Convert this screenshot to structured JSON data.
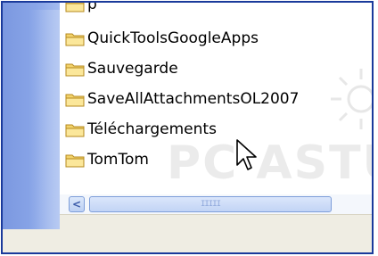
{
  "folders": [
    {
      "name": "p"
    },
    {
      "name": "QuickToolsGoogleApps"
    },
    {
      "name": "Sauvegarde"
    },
    {
      "name": "SaveAllAttachmentsOL2007"
    },
    {
      "name": "Téléchargements"
    },
    {
      "name": "TomTom"
    }
  ],
  "watermark": {
    "text": "PC ASTUC"
  },
  "scrollbar": {
    "left_arrow": "<",
    "grip": "IIIII"
  },
  "colors": {
    "frame_border": "#1a3a9b",
    "left_pane": "#8aa6e8",
    "folder_yellow": "#f3d36b",
    "scroll_blue": "#c2d4f5",
    "bottom_bar": "#efede3"
  },
  "icons": {
    "folder": "folder-icon",
    "cursor": "mouse-cursor-icon",
    "scroll_left": "arrow-left-icon"
  }
}
